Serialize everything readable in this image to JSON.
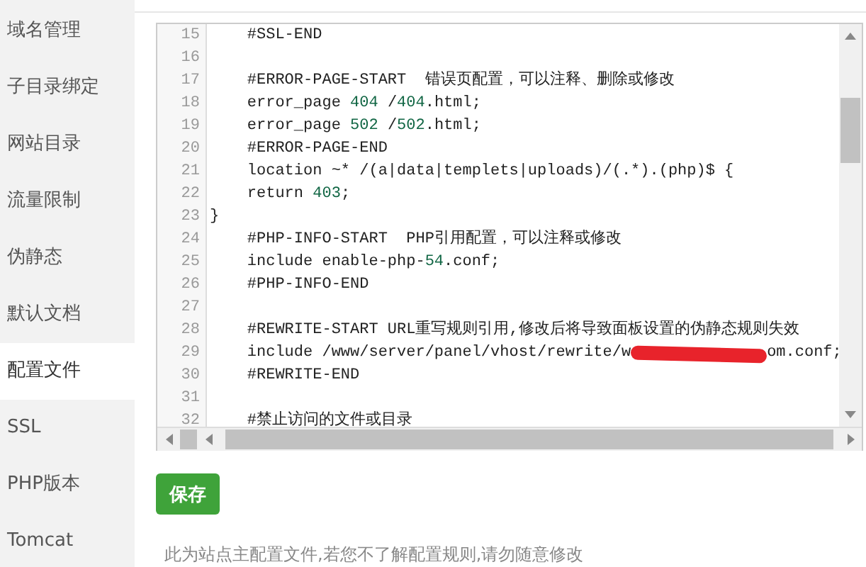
{
  "sidebar": {
    "items": [
      {
        "label": "域名管理",
        "selected": false
      },
      {
        "label": "子目录绑定",
        "selected": false
      },
      {
        "label": "网站目录",
        "selected": false
      },
      {
        "label": "流量限制",
        "selected": false
      },
      {
        "label": "伪静态",
        "selected": false
      },
      {
        "label": "默认文档",
        "selected": false
      },
      {
        "label": "配置文件",
        "selected": true
      },
      {
        "label": "SSL",
        "selected": false
      },
      {
        "label": "PHP版本",
        "selected": false
      },
      {
        "label": "Tomcat",
        "selected": false
      }
    ]
  },
  "editor": {
    "lines": [
      {
        "number": "15",
        "kind": "plain",
        "text": "    #SSL-END"
      },
      {
        "number": "16",
        "kind": "plain"
      },
      {
        "number": "17",
        "kind": "plain",
        "text": "    #ERROR-PAGE-START  错误页配置，可以注释、删除或修改"
      },
      {
        "number": "18",
        "kind": "plain",
        "text": "    error_page 404 /404.html;"
      },
      {
        "number": "19",
        "kind": "plain",
        "text": "    error_page 502 /502.html;"
      },
      {
        "number": "20",
        "kind": "plain",
        "text": "    #ERROR-PAGE-END"
      },
      {
        "number": "21",
        "kind": "plain",
        "text": "    location ~* /(a|data|templets|uploads)/(.*).(php)$ {"
      },
      {
        "number": "22",
        "kind": "plain",
        "text": "    return 403;"
      },
      {
        "number": "23",
        "kind": "plain",
        "text": "}"
      },
      {
        "number": "24",
        "kind": "plain",
        "text": "    #PHP-INFO-START  PHP引用配置，可以注释或修改"
      },
      {
        "number": "25",
        "kind": "plain",
        "text": "    include enable-php-54.conf;"
      },
      {
        "number": "26",
        "kind": "plain",
        "text": "    #PHP-INFO-END"
      },
      {
        "number": "27",
        "kind": "plain"
      },
      {
        "number": "28",
        "kind": "plain",
        "text": "    #REWRITE-START URL重写规则引用,修改后将导致面板设置的伪静态规则失效"
      },
      {
        "number": "29",
        "kind": "redacted",
        "text": "    include /www/server/panel/vhost/rewrite/w",
        "text_after": "om.conf;"
      },
      {
        "number": "30",
        "kind": "plain",
        "text": "    #REWRITE-END"
      },
      {
        "number": "31",
        "kind": "plain"
      },
      {
        "number": "32",
        "kind": "plain",
        "text": "    #禁止访问的文件或目录"
      }
    ]
  },
  "save_button": {
    "label": "保存"
  },
  "note": "此为站点主配置文件,若您不了解配置规则,请勿随意修改"
}
